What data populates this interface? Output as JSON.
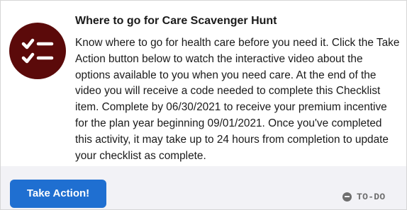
{
  "card": {
    "icon": "checklist-icon",
    "title": "Where to go for Care Scavenger Hunt",
    "description_lines": [
      "Know where to go for health care before you need it. Click the Take",
      "Action button below to watch the interactive video about the",
      "options available to you when you need care. At the end of the",
      "video you will receive a code needed to complete this Checklist",
      "item. Complete by 06/30/2021 to receive your premium incentive",
      "for the plan year beginning 09/01/2021. Once you've completed",
      "this activity, it may take up to 24 hours from completion to update",
      "your checklist as complete."
    ],
    "action_label": "Take Action!",
    "status_icon": "minus-circle-icon",
    "status_label": "TO-DO"
  },
  "colors": {
    "icon_background": "#5b0a0a",
    "button": "#1f6fd1",
    "footer_background": "#f2f2f6",
    "status": "#6e6e6e"
  }
}
